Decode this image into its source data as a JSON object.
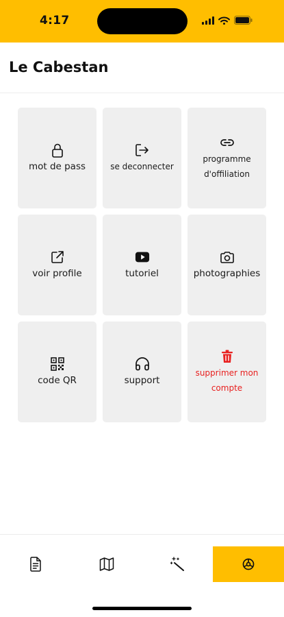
{
  "status_bar": {
    "time": "4:17",
    "icons": [
      "signal-icon",
      "wifi-icon",
      "battery-icon"
    ]
  },
  "header": {
    "title": "Le Cabestan"
  },
  "tiles": [
    {
      "label": "mot de pass",
      "icon": "lock-icon"
    },
    {
      "label": "se deconnecter",
      "icon": "logout-icon"
    },
    {
      "label": "programme d'offiliation",
      "icon": "link-icon"
    },
    {
      "label": "voir profile",
      "icon": "external-link-icon"
    },
    {
      "label": "tutoriel",
      "icon": "youtube-icon"
    },
    {
      "label": "photographies",
      "icon": "camera-icon"
    },
    {
      "label": "code QR",
      "icon": "qr-code-icon"
    },
    {
      "label": "support",
      "icon": "headphones-icon"
    },
    {
      "label": "supprimer mon compte",
      "icon": "trash-icon"
    }
  ],
  "bottom_nav": {
    "items": [
      "document-icon",
      "map-icon",
      "magic-wand-icon",
      "settings-icon"
    ],
    "active": "settings-icon"
  },
  "colors": {
    "accent": "#FFBE00",
    "tile_bg": "#EFEFEF",
    "danger": "#E8201F"
  }
}
